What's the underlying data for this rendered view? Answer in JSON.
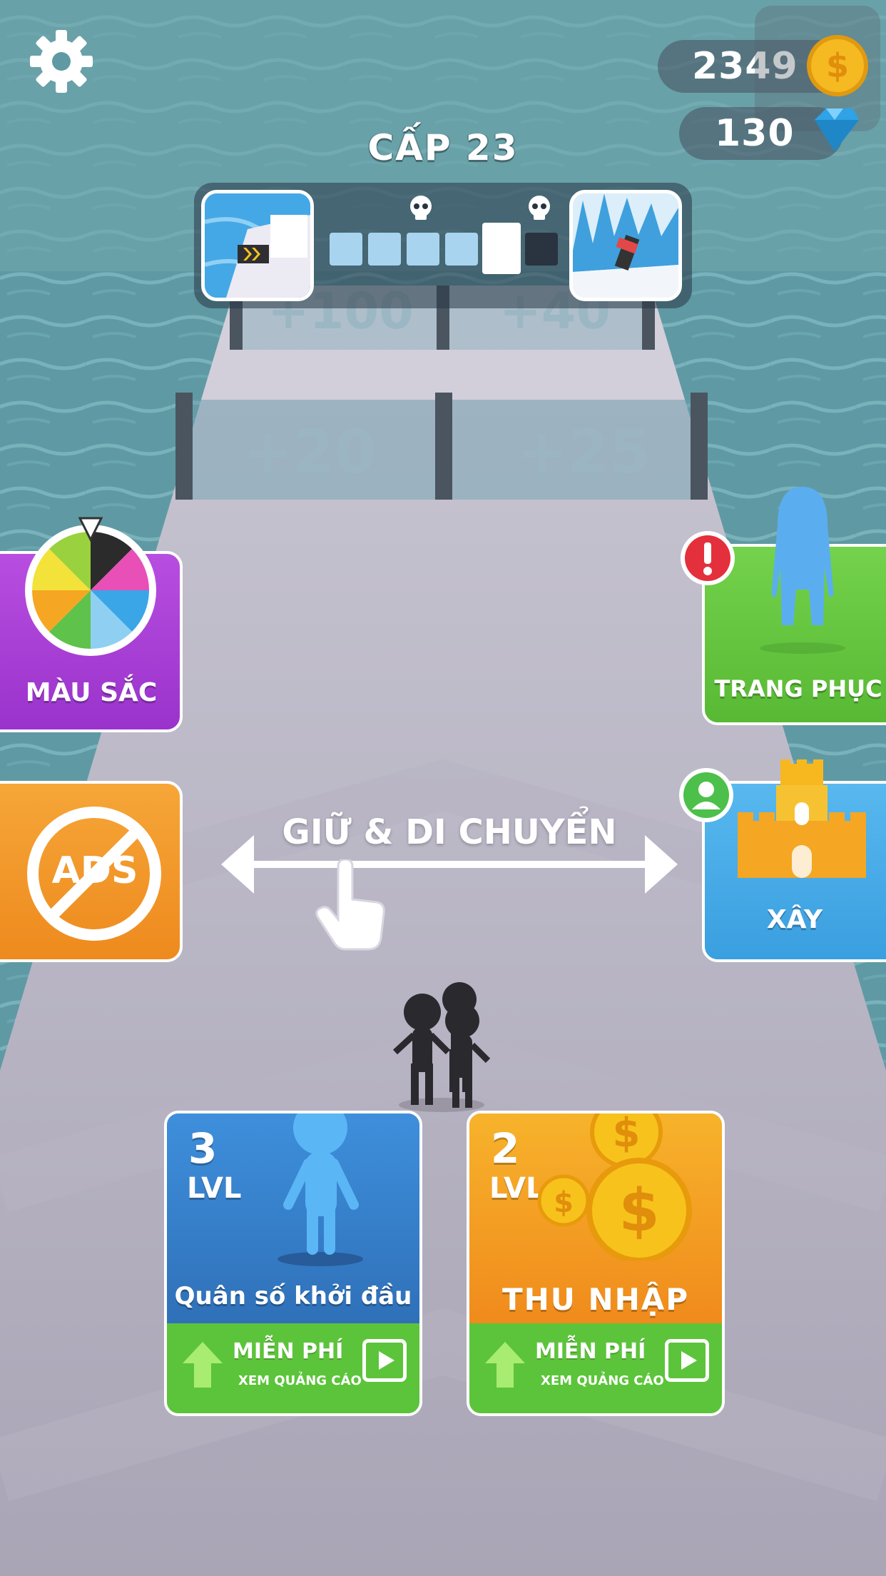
{
  "hud": {
    "coins": "2349",
    "gems": "130",
    "level_title": "CẤP 23"
  },
  "track": {
    "gate_far_left": "+100",
    "gate_far_right": "+40",
    "gate_left": "+20",
    "gate_right": "+25"
  },
  "side_buttons": {
    "colors_label": "MÀU SẮC",
    "outfit_label": "TRANG PHỤC",
    "build_label": "XÂY",
    "no_ads_text": "ADS"
  },
  "tutorial": {
    "hint": "GIỮ & DI CHUYỂN"
  },
  "cards": {
    "crowd": {
      "level_num": "3",
      "level_unit": "LVL",
      "title": "Quân số khởi đầu",
      "free": "MIỄN PHÍ",
      "watch_ad": "XEM QUẢNG CÁO"
    },
    "income": {
      "level_num": "2",
      "level_unit": "LVL",
      "title": "THU NHẬP",
      "free": "MIỄN PHÍ",
      "watch_ad": "XEM QUẢNG CÁO"
    }
  },
  "colors": {
    "water": "#5f9aa4",
    "road": "#a9a5b6",
    "purple_btn": "#a63fd6",
    "green_btn": "#62c43e",
    "orange_btn": "#f29a28",
    "blue_btn": "#3aa7e8",
    "coin": "#f5b921",
    "gem": "#2fa3e6"
  }
}
